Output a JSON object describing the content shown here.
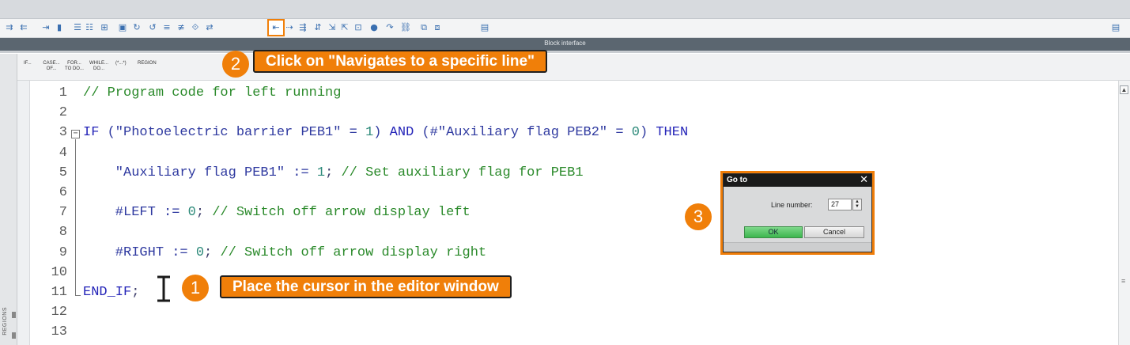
{
  "toolbar": {
    "icons": [
      "indent-icon",
      "outdent-icon",
      "insert-indent-icon",
      "bookmark-icon",
      "list-icon",
      "block-list-icon",
      "instance-icon",
      "view-icon",
      "watch-on-icon",
      "watch-off-icon",
      "comment-icon",
      "uncomment-icon",
      "region-icon",
      "jump-icon",
      "navigate-to-line-icon",
      "goto-icon",
      "indent-right-icon",
      "split-icon",
      "align-icon",
      "align-2-icon",
      "format-icon",
      "breakpoint-icon",
      "step-icon",
      "link-icon",
      "compare-icon",
      "compare-2-icon",
      "db-icon"
    ],
    "highlight_color": "#f07f09"
  },
  "block_interface": {
    "title": "Block interface"
  },
  "keywords": [
    {
      "label": "IF..."
    },
    {
      "label": "CASE... OF..."
    },
    {
      "label": "FOR... TO DO..."
    },
    {
      "label": "WHILE... DO..."
    },
    {
      "label": "(*...*)"
    },
    {
      "label": "REGION"
    }
  ],
  "regions_rail": {
    "label": "REGIONS"
  },
  "editor": {
    "lines": [
      {
        "n": "1",
        "segs": [
          {
            "t": "// Program code for left running",
            "c": "cm"
          }
        ]
      },
      {
        "n": "2",
        "segs": []
      },
      {
        "n": "3",
        "segs": [
          {
            "t": "IF",
            "c": "kwc"
          },
          {
            "t": " (\"Photoelectric barrier PEB1\" = ",
            "c": "str"
          },
          {
            "t": "1",
            "c": "num"
          },
          {
            "t": ") ",
            "c": "str"
          },
          {
            "t": "AND",
            "c": "kwc"
          },
          {
            "t": " (#\"Auxiliary flag PEB2\" = ",
            "c": "str"
          },
          {
            "t": "0",
            "c": "num"
          },
          {
            "t": ") ",
            "c": "str"
          },
          {
            "t": "THEN",
            "c": "kwc"
          }
        ]
      },
      {
        "n": "4",
        "segs": []
      },
      {
        "n": "5",
        "segs": [
          {
            "t": "    \"Auxiliary flag PEB1\" := ",
            "c": "str"
          },
          {
            "t": "1",
            "c": "num"
          },
          {
            "t": "; ",
            "c": "plain"
          },
          {
            "t": "// Set auxiliary flag for PEB1",
            "c": "cm"
          }
        ]
      },
      {
        "n": "6",
        "segs": []
      },
      {
        "n": "7",
        "segs": [
          {
            "t": "    #LEFT := ",
            "c": "str"
          },
          {
            "t": "0",
            "c": "num"
          },
          {
            "t": "; ",
            "c": "plain"
          },
          {
            "t": "// Switch off arrow display left",
            "c": "cm"
          }
        ]
      },
      {
        "n": "8",
        "segs": []
      },
      {
        "n": "9",
        "segs": [
          {
            "t": "    #RIGHT := ",
            "c": "str"
          },
          {
            "t": "0",
            "c": "num"
          },
          {
            "t": "; ",
            "c": "plain"
          },
          {
            "t": "// Switch off arrow display right",
            "c": "cm"
          }
        ]
      },
      {
        "n": "10",
        "segs": []
      },
      {
        "n": "11",
        "segs": [
          {
            "t": "END_IF",
            "c": "kwc"
          },
          {
            "t": ";",
            "c": "plain"
          }
        ]
      },
      {
        "n": "12",
        "segs": []
      },
      {
        "n": "13",
        "segs": []
      }
    ]
  },
  "callouts": [
    {
      "num": "1",
      "text": "Place the cursor in the editor window"
    },
    {
      "num": "2",
      "text": "Click on \"Navigates to a specific line\""
    },
    {
      "num": "3",
      "text": ""
    }
  ],
  "goto_dialog": {
    "title": "Go to",
    "line_number_label": "Line number:",
    "line_number_value": "27",
    "ok_label": "OK",
    "cancel_label": "Cancel"
  }
}
